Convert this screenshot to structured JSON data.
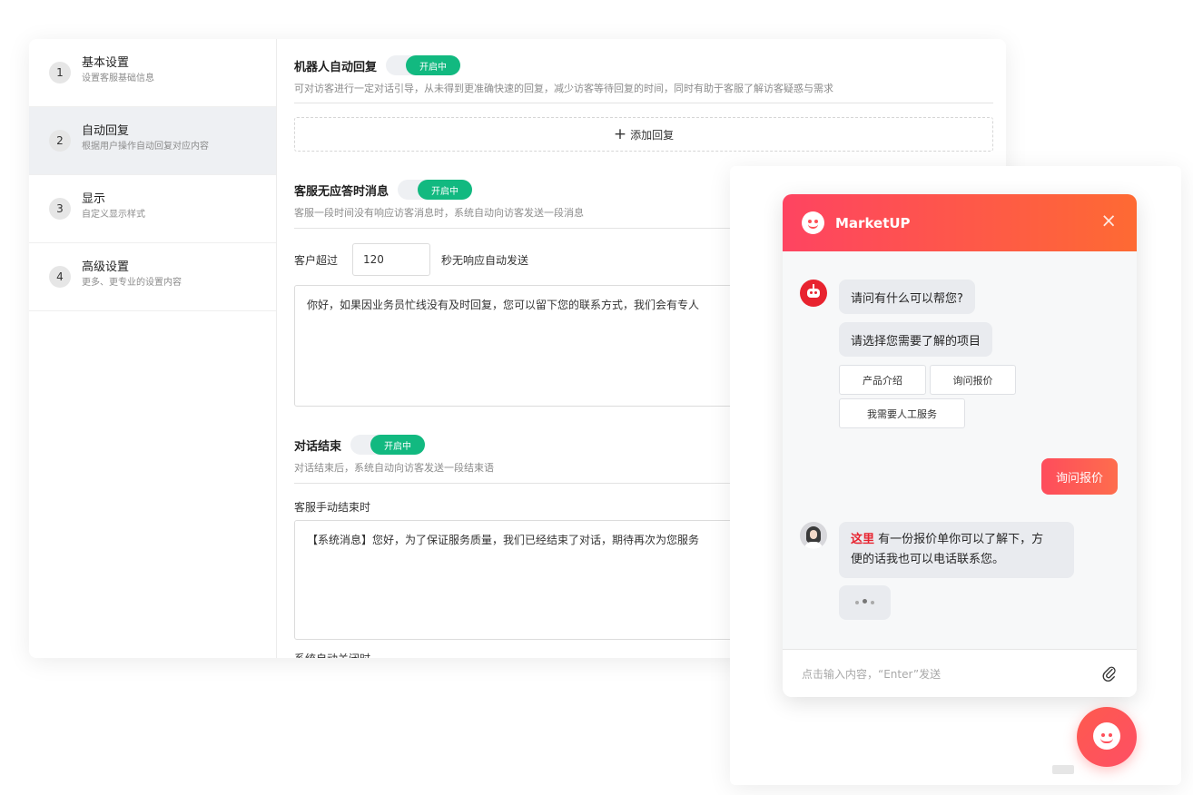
{
  "sidebar": {
    "items": [
      {
        "num": "1",
        "title": "基本设置",
        "desc": "设置客服基础信息"
      },
      {
        "num": "2",
        "title": "自动回复",
        "desc": "根据用户操作自动回复对应内容",
        "active": true
      },
      {
        "num": "3",
        "title": "显示",
        "desc": "自定义显示样式"
      },
      {
        "num": "4",
        "title": "高级设置",
        "desc": "更多、更专业的设置内容"
      }
    ]
  },
  "robot_reply": {
    "title": "机器人自动回复",
    "toggle": "开启中",
    "desc": "可对访客进行一定对话引导，从未得到更准确快速的回复，减少访客等待回复的时间，同时有助于客服了解访客疑惑与需求",
    "add_label": "添加回复"
  },
  "no_response": {
    "title": "客服无应答时消息",
    "toggle": "开启中",
    "desc": "客服一段时间没有响应访客消息时，系统自动向访客发送一段消息",
    "prefix": "客户超过",
    "seconds": "120",
    "suffix": "秒无响应自动发送",
    "message": "你好，如果因业务员忙线没有及时回复，您可以留下您的联系方式，我们会有专人"
  },
  "end_chat": {
    "title": "对话结束",
    "toggle": "开启中",
    "desc": "对话结束后，系统自动向访客发送一段结束语",
    "manual_label": "客服手动结束时",
    "manual_message": "【系统消息】您好，为了保证服务质量，我们已经结束了对话，期待再次为您服务",
    "auto_label": "系统自动关闭时"
  },
  "chat": {
    "brand": "MarketUP",
    "close_icon": "×",
    "bot_messages": [
      "请问有什么可以帮您?",
      "请选择您需要了解的项目"
    ],
    "quick_replies": [
      "产品介绍",
      "询问报价",
      "我需要人工服务"
    ],
    "user_message": "询问报价",
    "agent_highlight": "这里",
    "agent_text_1": " 有一份报价单你可以了解下，方",
    "agent_text_2": "便的话我也可以电话联系您。",
    "input_placeholder": "点击输入内容，“Enter”发送"
  },
  "colors": {
    "accent_green": "#12b980",
    "brand_red": "#fe4461",
    "brand_orange": "#fe6a33"
  },
  "icons": {
    "attach": "paperclip-icon",
    "close": "close-icon",
    "launcher": "chat-launcher-icon"
  }
}
